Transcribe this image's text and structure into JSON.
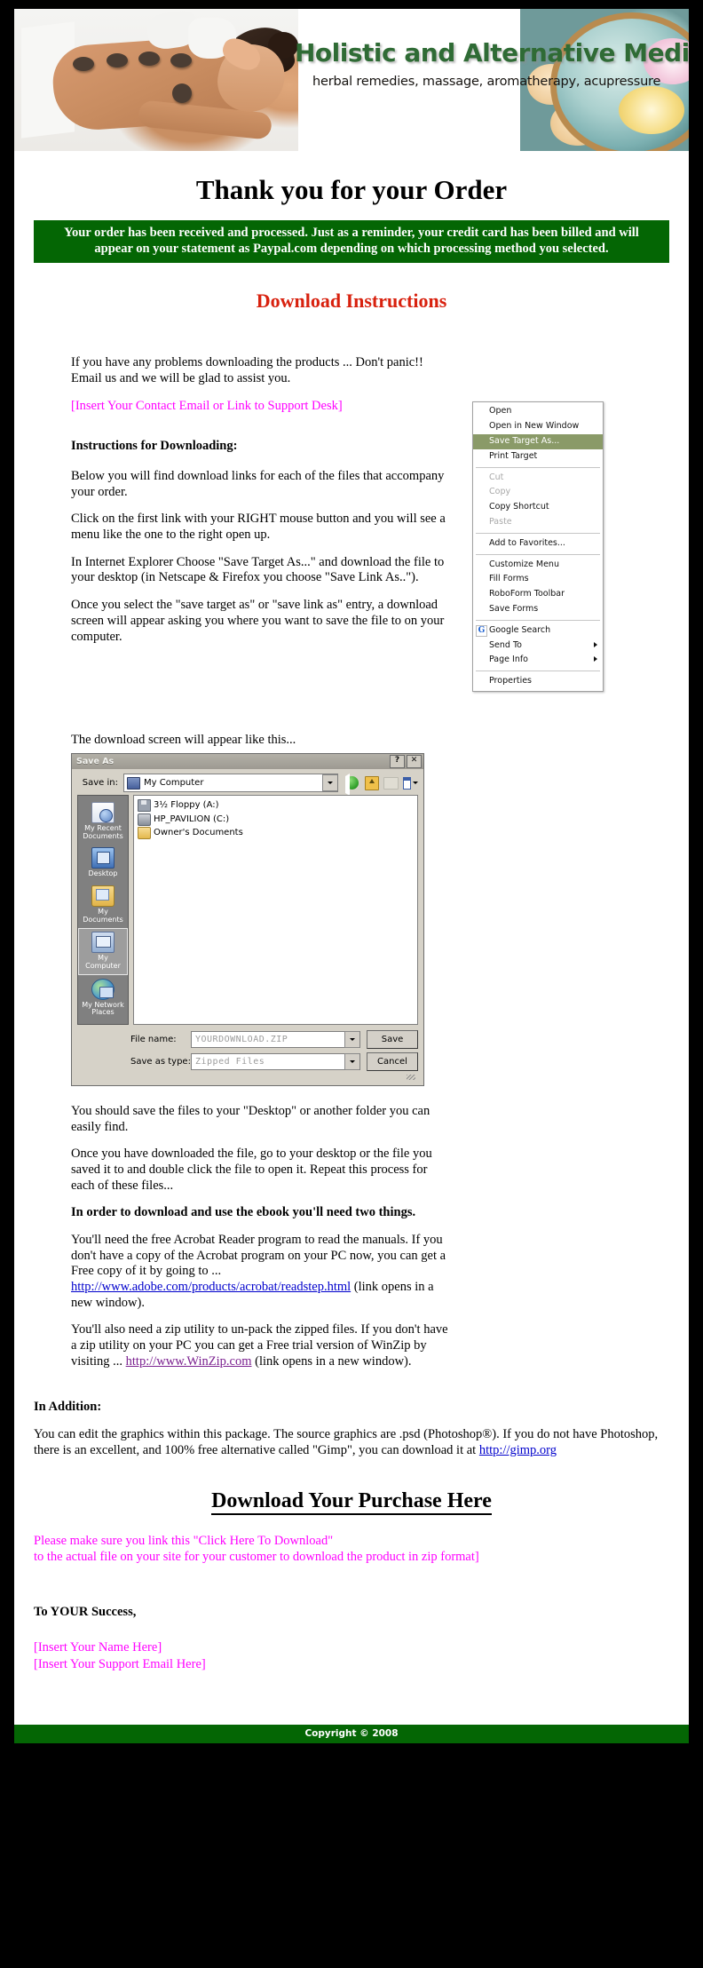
{
  "banner": {
    "title": "Holistic and Alternative Medicine",
    "subtitle": "herbal remedies, massage, aromatherapy, acupressure",
    "photo_left_alt": "hot-stone-massage-photo",
    "photo_right_alt": "aromatherapy-bowl-photo",
    "title_color": "#2f6b35"
  },
  "page_title": "Thank you for your Order",
  "order_notice": "Your order has been received and processed. Just as a reminder, your credit card has been billed and will appear on your statement as Paypal.com depending on which processing method you selected.",
  "notice_bg": "#046604",
  "download_instructions_heading": "Download Instructions",
  "heading_color": "#d8210e",
  "intro": {
    "line1": "If you have any problems downloading the products ... Don't panic!!",
    "line2": "Email us and we will be glad to assist you.",
    "support_placeholder": "[Insert Your Contact Email or Link to Support Desk]",
    "placeholder_color": "#ff00ff"
  },
  "instructions": {
    "heading": "Instructions for Downloading:",
    "p1": "Below you will find download links for each of the files that accompany your order.",
    "p2": "Click on the first link with your RIGHT mouse button and you will see a menu like the one to the right open up.",
    "p3": "In Internet Explorer Choose \"Save Target As...\" and download the file to your desktop (in Netscape & Firefox you choose \"Save Link As..\").",
    "p4": "Once you select the \"save target as\" or \"save link as\" entry, a download screen will appear asking you where you want to save the file to on your computer."
  },
  "context_menu": {
    "selected_bg": "#8a9a68",
    "groups": [
      [
        {
          "label": "Open",
          "state": "normal"
        },
        {
          "label": "Open in New Window",
          "state": "normal"
        },
        {
          "label": "Save Target As...",
          "state": "selected"
        },
        {
          "label": "Print Target",
          "state": "normal"
        }
      ],
      [
        {
          "label": "Cut",
          "state": "disabled"
        },
        {
          "label": "Copy",
          "state": "disabled"
        },
        {
          "label": "Copy Shortcut",
          "state": "normal"
        },
        {
          "label": "Paste",
          "state": "disabled"
        }
      ],
      [
        {
          "label": "Add to Favorites...",
          "state": "normal"
        }
      ],
      [
        {
          "label": "Customize Menu",
          "state": "normal"
        },
        {
          "label": "Fill Forms",
          "state": "normal"
        },
        {
          "label": "RoboForm Toolbar",
          "state": "normal"
        },
        {
          "label": "Save Forms",
          "state": "normal"
        }
      ],
      [
        {
          "label": "Google Search",
          "state": "normal",
          "icon": "google-g-icon",
          "icon_glyph": "G"
        },
        {
          "label": "Send To",
          "state": "normal",
          "submenu": true
        },
        {
          "label": "Page Info",
          "state": "normal",
          "submenu": true
        }
      ],
      [
        {
          "label": "Properties",
          "state": "normal"
        }
      ]
    ]
  },
  "dialog_caption": "The download screen will appear like this...",
  "save_as_dialog": {
    "title": "Save As",
    "help_button": "?",
    "close_button": "✕",
    "save_in_label": "Save in:",
    "save_in_value": "My Computer",
    "toolbar_icons": [
      "back-icon",
      "up-one-level-icon",
      "new-folder-icon",
      "views-icon"
    ],
    "places": [
      {
        "label": "My Recent Documents",
        "icon": "recent-documents-icon",
        "selected": false
      },
      {
        "label": "Desktop",
        "icon": "desktop-icon",
        "selected": false
      },
      {
        "label": "My Documents",
        "icon": "my-documents-icon",
        "selected": false
      },
      {
        "label": "My Computer",
        "icon": "my-computer-icon",
        "selected": true
      },
      {
        "label": "My Network Places",
        "icon": "my-network-places-icon",
        "selected": false
      }
    ],
    "files": [
      {
        "label": "3½ Floppy (A:)",
        "icon": "floppy-drive-icon"
      },
      {
        "label": "HP_PAVILION (C:)",
        "icon": "hard-drive-icon"
      },
      {
        "label": "Owner's Documents",
        "icon": "folder-icon"
      }
    ],
    "file_name_label": "File name:",
    "file_name_value": "YOURDOWNLOAD.ZIP",
    "save_as_type_label": "Save as type:",
    "save_as_type_value": "Zipped Files",
    "save_button": "Save",
    "cancel_button": "Cancel"
  },
  "after_dialog": {
    "p1": "You should save the files to your \"Desktop\" or another folder you can easily find.",
    "p2": "Once you have downloaded the file, go to your desktop or the file you saved it to and double click the file to open it. Repeat this process for each of these files...",
    "bold": "In order to download and use the ebook you'll need two things.",
    "p3a": "You'll need the free Acrobat Reader program to read the manuals. If you don't have a copy of the Acrobat program on your PC now, you can get a Free copy of it by going to ... ",
    "p3_link": "http://www.adobe.com/products/acrobat/readstep.html",
    "p3b": " (link opens in a new window).",
    "p4a": "You'll also need a zip utility to un-pack the zipped files. If you don't have a zip utility on your PC you can get a Free trial version of WinZip by visiting ... ",
    "p4_link": "http://www.WinZip.com",
    "p4b": "  (link opens in a new window)."
  },
  "in_addition": {
    "heading": "In Addition:",
    "text_a": "You can edit the graphics within this package. The source graphics are .psd (Photoshop®). If you do not have Photoshop, there is an excellent, and 100% free alternative called \"Gimp\", you can download it at ",
    "link": "http://gimp.org"
  },
  "download_here": {
    "heading": "Download Your Purchase Here",
    "note_line1": "Please make sure you link this \"Click Here To Download\"",
    "note_line2": "to the actual file on your site for your customer to download the product in zip format]"
  },
  "closing": {
    "success": "To YOUR Success,",
    "name_placeholder": "[Insert Your Name Here]",
    "email_placeholder": "[Insert Your Support Email Here]"
  },
  "footer": {
    "copyright": "Copyright © 2008",
    "bg": "#046604"
  }
}
